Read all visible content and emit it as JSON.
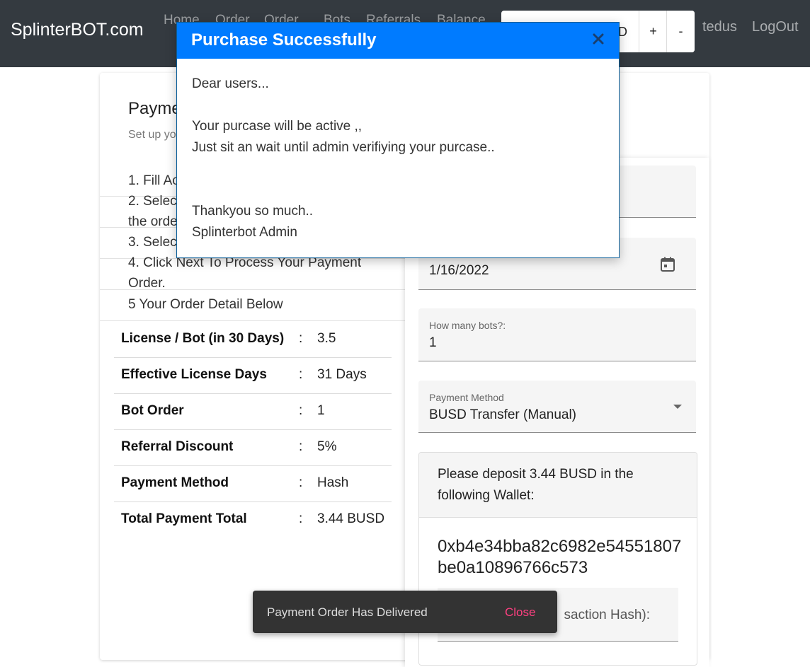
{
  "navbar": {
    "brand": "SplinterBOT.com",
    "links": [
      "Home",
      "Order",
      "Order",
      "Bots",
      "Referrals",
      "Balance"
    ],
    "balance_suffix": "D",
    "plus_label": "+",
    "minus_label": "-",
    "username": "tedus",
    "logout_label": "LogOut"
  },
  "main": {
    "title_partial": "Payme",
    "subtitle_partial": "Set up yo",
    "steps": [
      "1. Fill Ac",
      "2. Selec",
      "the orde",
      "3. Selec",
      "4. Click Next To Process Your Payment Order.",
      "5 Your Order Detail Below"
    ],
    "summary": [
      {
        "label": "License / Bot (in 30 Days)",
        "value": "3.5"
      },
      {
        "label": "Effective License Days",
        "value": "31 Days"
      },
      {
        "label": "Bot Order",
        "value": "1"
      },
      {
        "label": "Referral Discount",
        "value": "5%"
      },
      {
        "label": "Payment Method",
        "value": "Hash"
      },
      {
        "label": "Total Payment Total",
        "value": "3.44 BUSD"
      }
    ],
    "colon": ":"
  },
  "form": {
    "date_value": "1/16/2022",
    "bots_label": "How many bots?:",
    "bots_value": "1",
    "method_label": "Payment Method",
    "method_value": "BUSD Transfer (Manual)",
    "deposit_text": "Please deposit 3.44 BUSD in the following Wallet:",
    "wallet_address": "0xb4e34bba82c6982e54551807be0a10896766c573",
    "hash_label_partial": "saction Hash):"
  },
  "snackbar": {
    "message": "Payment Order Has Delivered",
    "close_label": "Close"
  },
  "modal": {
    "title": "Purchase Successfully",
    "lines": [
      "Dear users...",
      "",
      "Your purcase will be active ,,",
      "Just sit an wait until admin verifiying your purcase..",
      "",
      "",
      "Thankyou so much..",
      "Splinterbot Admin"
    ]
  },
  "colors": {
    "navbar_bg": "#343a40",
    "modal_header": "#007bff",
    "snackbar_bg": "#333333",
    "snackbar_action": "#ff4081"
  },
  "icons": {
    "calendar": "calendar-icon",
    "dropdown": "chevron-down-icon",
    "close": "close-icon"
  }
}
